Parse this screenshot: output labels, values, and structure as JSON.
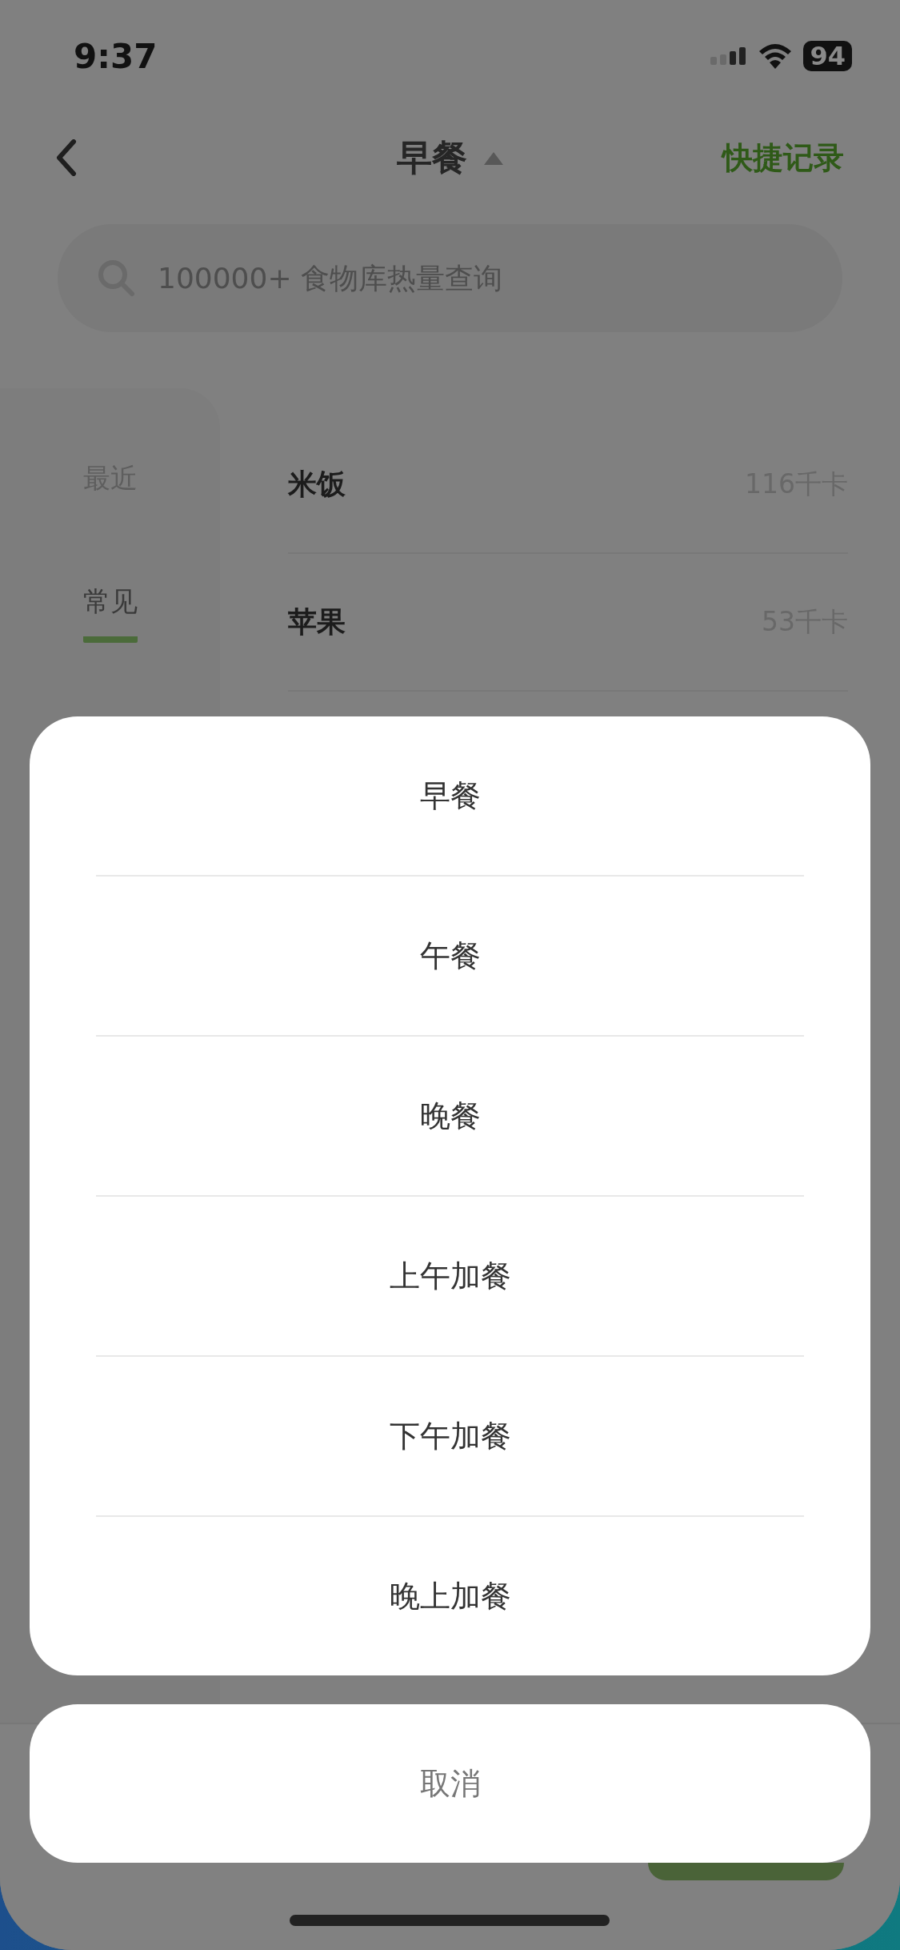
{
  "status_bar": {
    "time": "9:37",
    "battery": "94"
  },
  "header": {
    "title": "早餐",
    "action": "快捷记录"
  },
  "search": {
    "placeholder": "100000+ 食物库热量查询"
  },
  "sidebar": {
    "items": [
      {
        "label": "最近",
        "selected": false
      },
      {
        "label": "常见",
        "selected": true
      }
    ]
  },
  "foods": [
    {
      "name": "米饭",
      "calories": "116千卡"
    },
    {
      "name": "苹果",
      "calories": "53千卡"
    }
  ],
  "meal_sheet": {
    "options": [
      "早餐",
      "午餐",
      "晚餐",
      "上午加餐",
      "下午加餐",
      "晚上加餐"
    ],
    "cancel": "取消"
  }
}
